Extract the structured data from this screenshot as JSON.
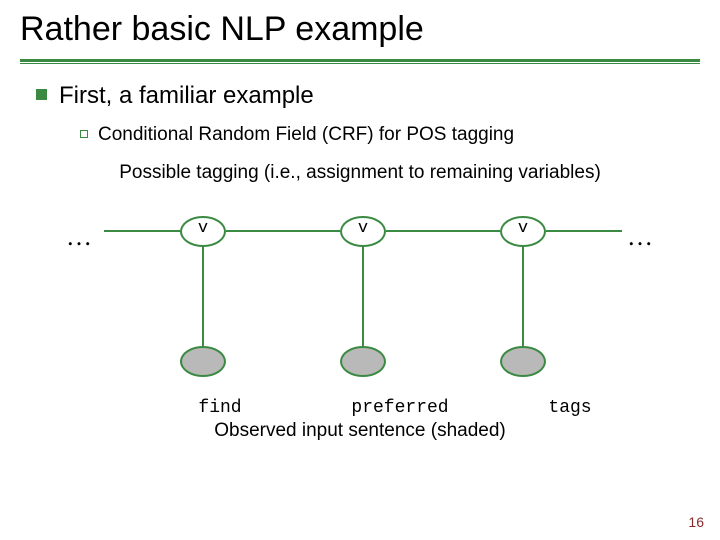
{
  "title": "Rather basic NLP example",
  "bullets": {
    "l1": "First, a familiar example",
    "l2": "Conditional Random Field (CRF) for POS tagging"
  },
  "captions": {
    "top": "Possible tagging (i.e., assignment to remaining variables)",
    "bottom": "Observed input sentence (shaded)"
  },
  "ellipsis": "…",
  "tags": {
    "t1": "v",
    "t2": "v",
    "t3": "v"
  },
  "words": {
    "w1": "find",
    "w2": "preferred",
    "w3": "tags"
  },
  "page": "16"
}
